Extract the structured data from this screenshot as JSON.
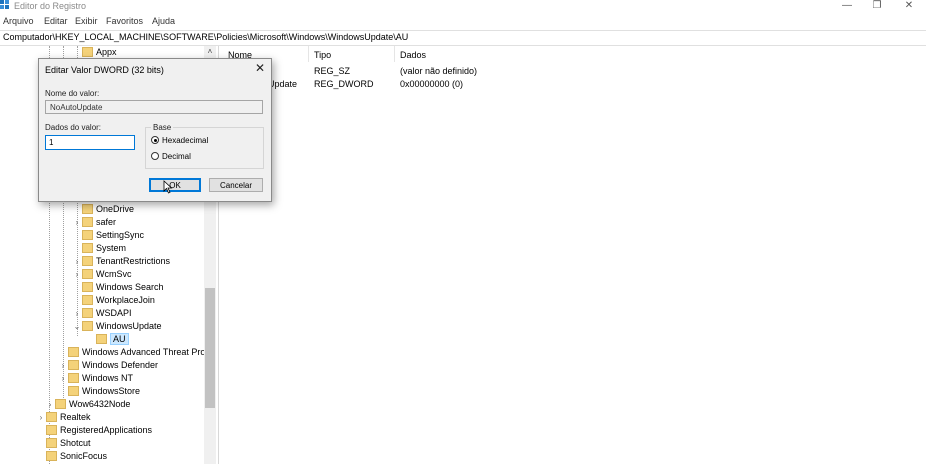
{
  "window": {
    "title": "Editor do Registro",
    "controls": {
      "minimize": "—",
      "maximize": "❐",
      "close": "✕"
    },
    "icon": "regedit-icon"
  },
  "menu": [
    "Arquivo",
    "Editar",
    "Exibir",
    "Favoritos",
    "Ajuda"
  ],
  "address": "Computador\\HKEY_LOCAL_MACHINE\\SOFTWARE\\Policies\\Microsoft\\Windows\\WindowsUpdate\\AU",
  "tree": {
    "top_item": "Appx",
    "items": [
      {
        "label": "OneDrive"
      },
      {
        "label": "safer"
      },
      {
        "label": "SettingSync"
      },
      {
        "label": "System"
      },
      {
        "label": "TenantRestrictions"
      },
      {
        "label": "WcmSvc"
      },
      {
        "label": "Windows Search"
      },
      {
        "label": "WorkplaceJoin"
      },
      {
        "label": "WSDAPI"
      },
      {
        "label": "WindowsUpdate"
      },
      {
        "label": "AU"
      },
      {
        "label": "Windows Advanced Threat Pro"
      },
      {
        "label": "Windows Defender"
      },
      {
        "label": "Windows NT"
      },
      {
        "label": "WindowsStore"
      },
      {
        "label": "Wow6432Node"
      },
      {
        "label": "Realtek"
      },
      {
        "label": "RegisteredApplications"
      },
      {
        "label": "Shotcut"
      },
      {
        "label": "SonicFocus"
      }
    ]
  },
  "list": {
    "columns": [
      "Nome",
      "Tipo",
      "Dados"
    ],
    "rows": [
      {
        "name": "",
        "type": "REG_SZ",
        "data": "(valor não definido)"
      },
      {
        "name": "Update",
        "type": "REG_DWORD",
        "data": "0x00000000 (0)"
      }
    ]
  },
  "dialog": {
    "title": "Editar Valor DWORD (32 bits)",
    "name_label": "Nome do valor:",
    "name_value": "NoAutoUpdate",
    "data_label": "Dados do valor:",
    "data_value": "1",
    "base_label": "Base",
    "radio_hex": "Hexadecimal",
    "radio_dec": "Decimal",
    "base_selected": "Hexadecimal",
    "ok": "OK",
    "cancel": "Cancelar",
    "close": "✕"
  }
}
